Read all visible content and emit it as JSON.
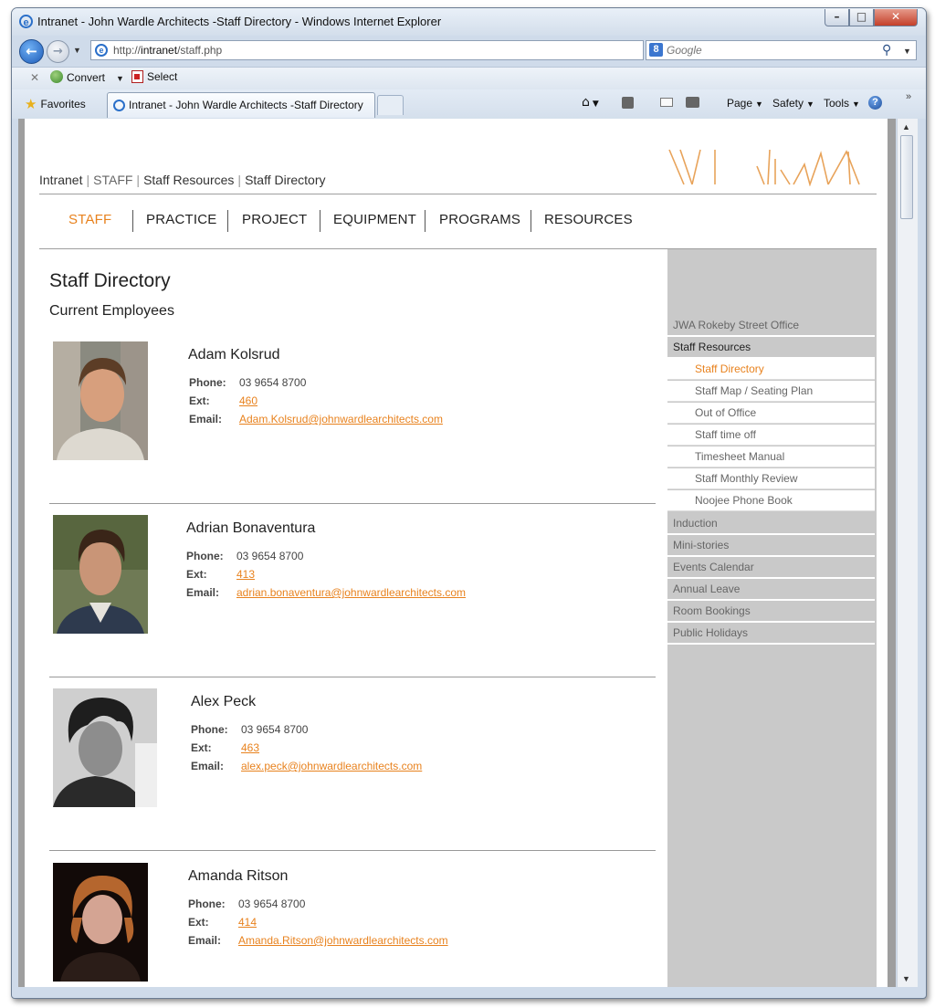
{
  "window": {
    "title": "Intranet - John Wardle Architects -Staff Directory - Windows Internet Explorer",
    "buttons": {
      "minimize": "–",
      "maximize": "□",
      "close": "✕"
    }
  },
  "addressbar": {
    "url_prefix": "http://",
    "url_host": "intranet",
    "url_path": "/staff.php",
    "search_placeholder": "Google"
  },
  "commandbar": {
    "convert_label": "Convert",
    "select_label": "Select"
  },
  "favbar": {
    "favorites_label": "Favorites",
    "tab_label": "Intranet - John Wardle Architects -Staff Directory",
    "page_menu": "Page",
    "safety_menu": "Safety",
    "tools_menu": "Tools"
  },
  "site": {
    "breadcrumb": [
      {
        "label": "Intranet"
      },
      {
        "label": "STAFF"
      },
      {
        "label": "Staff Resources"
      },
      {
        "label": "Staff Directory"
      }
    ],
    "nav": [
      {
        "label": "STAFF",
        "active": true
      },
      {
        "label": "PRACTICE"
      },
      {
        "label": "PROJECT"
      },
      {
        "label": "EQUIPMENT"
      },
      {
        "label": "PROGRAMS"
      },
      {
        "label": "RESOURCES"
      }
    ],
    "page_title": "Staff Directory",
    "page_subtitle": "Current Employees",
    "field_labels": {
      "phone": "Phone:",
      "ext": "Ext:",
      "email": "Email:"
    },
    "employees": [
      {
        "name": "Adam Kolsrud",
        "phone": "03 9654 8700",
        "ext": "460",
        "email": "Adam.Kolsrud@johnwardlearchitects.com"
      },
      {
        "name": "Adrian Bonaventura",
        "phone": "03 9654 8700",
        "ext": "413",
        "email": "adrian.bonaventura@johnwardlearchitects.com"
      },
      {
        "name": "Alex Peck",
        "phone": "03 9654 8700",
        "ext": "463",
        "email": "alex.peck@johnwardlearchitects.com"
      },
      {
        "name": "Amanda Ritson",
        "phone": "03 9654 8700",
        "ext": "414",
        "email": "Amanda.Ritson@johnwardlearchitects.com"
      }
    ],
    "sidebar": {
      "top_items": [
        {
          "label": "JWA Rokeby Street Office"
        },
        {
          "label": "Staff Resources",
          "active": true
        }
      ],
      "sub_items": [
        {
          "label": "Staff Directory",
          "current": true
        },
        {
          "label": "Staff Map / Seating Plan"
        },
        {
          "label": "Out of Office"
        },
        {
          "label": "Staff time off"
        },
        {
          "label": "Timesheet Manual"
        },
        {
          "label": "Staff Monthly Review"
        },
        {
          "label": "Noojee Phone Book"
        }
      ],
      "bottom_items": [
        {
          "label": "Induction"
        },
        {
          "label": "Mini-stories"
        },
        {
          "label": "Events Calendar"
        },
        {
          "label": "Annual Leave"
        },
        {
          "label": "Room Bookings"
        },
        {
          "label": "Public Holidays"
        }
      ]
    }
  },
  "colors": {
    "accent": "#e8821e",
    "sidebar_bg": "#c9c9c9"
  }
}
